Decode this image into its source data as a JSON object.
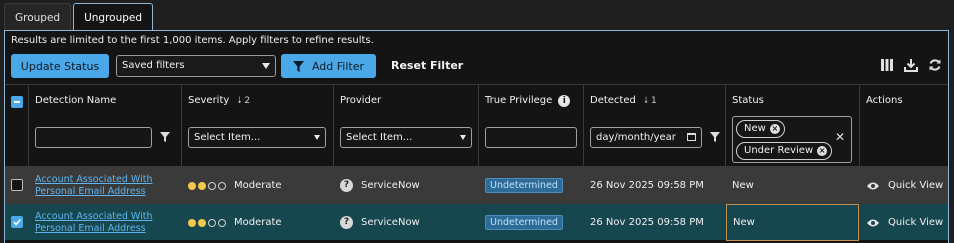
{
  "tabs": [
    {
      "label": "Grouped"
    },
    {
      "label": "Ungrouped"
    }
  ],
  "notice": "Results are limited to the first 1,000 items. Apply filters to refine results.",
  "toolbar": {
    "update_status": "Update Status",
    "saved_filters": "Saved filters",
    "add_filter": "Add Filter",
    "reset_filter": "Reset Filter"
  },
  "columns": {
    "detection_name": "Detection Name",
    "severity": "Severity",
    "severity_sort": "2",
    "provider": "Provider",
    "true_privilege": "True Privilege",
    "detected": "Detected",
    "detected_sort": "1",
    "status": "Status",
    "actions": "Actions"
  },
  "filters": {
    "severity_placeholder": "Select Item...",
    "provider_placeholder": "Select Item...",
    "detected_placeholder": "day/month/year",
    "status_chips": [
      "New",
      "Under Review"
    ]
  },
  "rows": [
    {
      "name_line1": "Account Associated With",
      "name_line2": "Personal Email Address",
      "severity": "Moderate",
      "provider": "ServiceNow",
      "true_privilege": "Undetermined",
      "detected": "26 Nov 2025 09:58 PM",
      "status": "New",
      "action": "Quick View",
      "checked": false
    },
    {
      "name_line1": "Account Associated With",
      "name_line2": "Personal Email Address",
      "severity": "Moderate",
      "provider": "ServiceNow",
      "true_privilege": "Undetermined",
      "detected": "26 Nov 2025 09:58 PM",
      "status": "New",
      "action": "Quick View",
      "checked": true
    }
  ],
  "colors": {
    "accent": "#4aa8e8",
    "selected_row": "#17474e",
    "severity_dot": "#f2c94c"
  }
}
